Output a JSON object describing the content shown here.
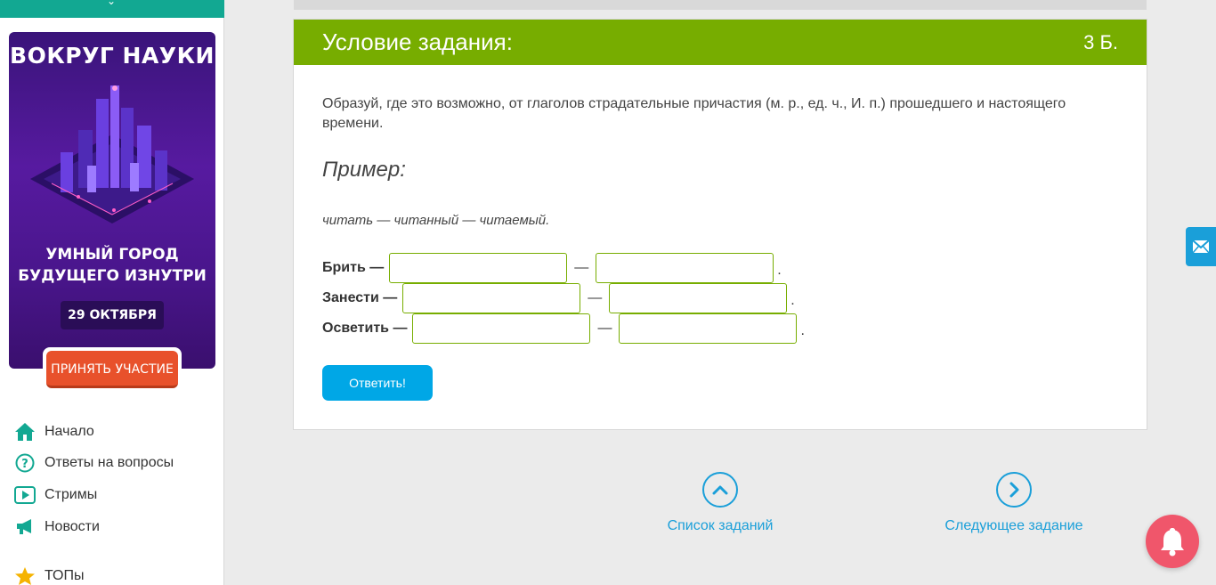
{
  "sidebar": {
    "banner": {
      "title": "ВОКРУГ НАУКИ",
      "subtitle_line1": "УМНЫЙ ГОРОД",
      "subtitle_line2": "БУДУЩЕГО ИЗНУТРИ",
      "date": "29 ОКТЯБРЯ",
      "cta": "ПРИНЯТЬ УЧАСТИЕ"
    },
    "items": [
      {
        "label": "Начало",
        "icon": "home-icon"
      },
      {
        "label": "Ответы на вопросы",
        "icon": "question-icon"
      },
      {
        "label": "Стримы",
        "icon": "play-icon"
      },
      {
        "label": "Новости",
        "icon": "megaphone-icon"
      },
      {
        "label": "ТОПы",
        "icon": "star-icon"
      }
    ]
  },
  "task": {
    "header_title": "Условие задания:",
    "points": "3 Б.",
    "text": "Образуй, где это возможно, от глаголов страдательные причастия (м. р., ед. ч., И. п.) прошедшего и настоящего времени.",
    "example_title": "Пример:",
    "example_text": "читать — читанный — читаемый.",
    "rows": [
      {
        "word": "Брить —"
      },
      {
        "word": "Занести —"
      },
      {
        "word": "Осветить —"
      }
    ],
    "dash": "—",
    "dot": ".",
    "answer_button": "Ответить!"
  },
  "bottom_nav": {
    "list_label": "Список заданий",
    "next_label": "Следующее задание"
  },
  "colors": {
    "header_green": "#77ad00",
    "accent_blue": "#1a9fd9",
    "button_blue": "#00a7e6",
    "bell_pink": "#f0566b",
    "sidebar_teal": "#12a892"
  }
}
